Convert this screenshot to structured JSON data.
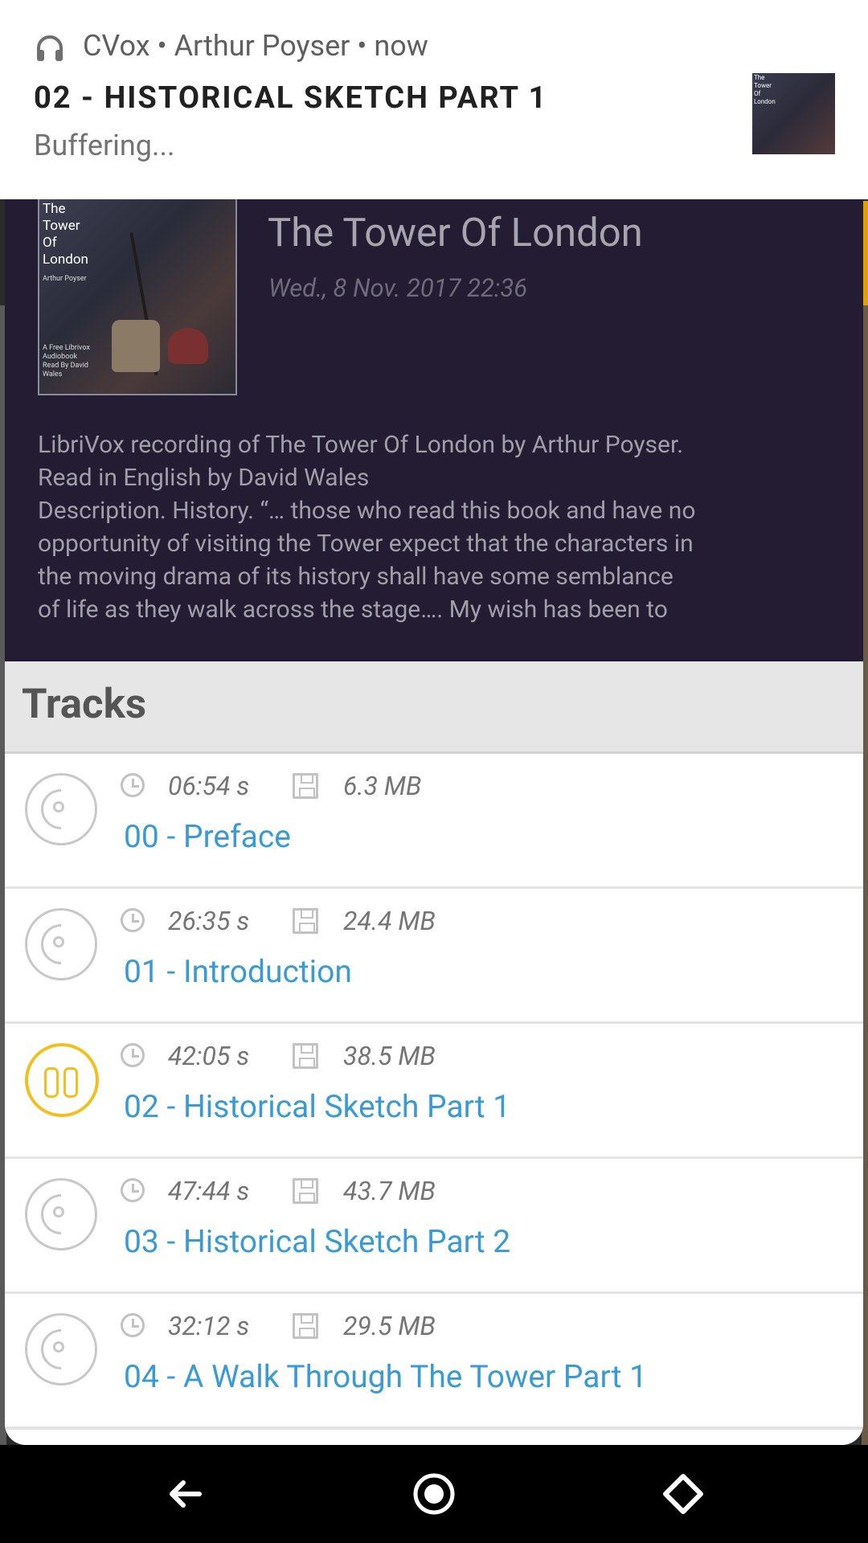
{
  "notification": {
    "app": "CVox",
    "author": "Arthur Poyser",
    "time": "now",
    "meta_line": "CVox • Arthur Poyser • now",
    "title": "02 - HISTORICAL SKETCH PART 1",
    "status": "Buffering...",
    "icon": "headphones-icon"
  },
  "book": {
    "title": "The Tower Of London",
    "date": "Wed., 8 Nov. 2017 22:36",
    "cover_lines": [
      "The",
      "Tower",
      "Of",
      "London"
    ],
    "cover_author": "Arthur Poyser",
    "cover_footer": "A Free Librivox Audiobook Read By David Wales",
    "description": "LibriVox recording of The Tower Of London by Arthur Poyser.\nRead in English by David Wales\nDescription. History. “… those who read this book and have no\nopportunity of visiting the Tower expect that the characters in\nthe moving drama of its history shall have some semblance\nof life as they walk across the stage…. My wish has been to"
  },
  "tracks": {
    "heading": "Tracks",
    "items": [
      {
        "duration": "06:54 s",
        "size": "6.3 MB",
        "name": "00 - Preface",
        "state": "idle"
      },
      {
        "duration": "26:35 s",
        "size": "24.4 MB",
        "name": "01 - Introduction",
        "state": "idle"
      },
      {
        "duration": "42:05 s",
        "size": "38.5 MB",
        "name": "02 - Historical Sketch Part 1",
        "state": "playing"
      },
      {
        "duration": "47:44 s",
        "size": "43.7 MB",
        "name": "03 - Historical Sketch Part 2",
        "state": "idle"
      },
      {
        "duration": "32:12 s",
        "size": "29.5 MB",
        "name": "04 - A Walk Through The Tower Part 1",
        "state": "idle"
      }
    ]
  },
  "colors": {
    "header_bg": "#231c33",
    "track_link": "#3a9ad4",
    "playing_accent": "#f2c01e"
  },
  "navbar": {
    "back_icon": "back-arrow-icon",
    "home_icon": "home-circle-icon",
    "recents_icon": "recents-diamond-icon"
  }
}
